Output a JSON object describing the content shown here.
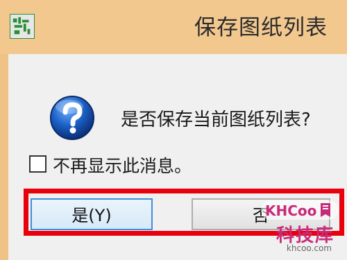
{
  "window": {
    "title": "保存图纸列表",
    "app_icon": "autocad-style-app-icon"
  },
  "dialog": {
    "icon": "question-icon",
    "message": "是否保存当前图纸列表?",
    "checkbox_label": "不再显示此消息。",
    "checkbox_checked": false,
    "buttons": {
      "yes_label": "是(Y)",
      "no_label": "否"
    },
    "highlight_color": "#e8000c"
  },
  "watermark": {
    "logo_text": "KHCOO",
    "brand_cn": "科技库",
    "url": "khcoo.com"
  },
  "colors": {
    "title_bar": "#f2c88f",
    "client_bg": "#f0f0f0",
    "accent_button_border": "#3c8fdb"
  }
}
